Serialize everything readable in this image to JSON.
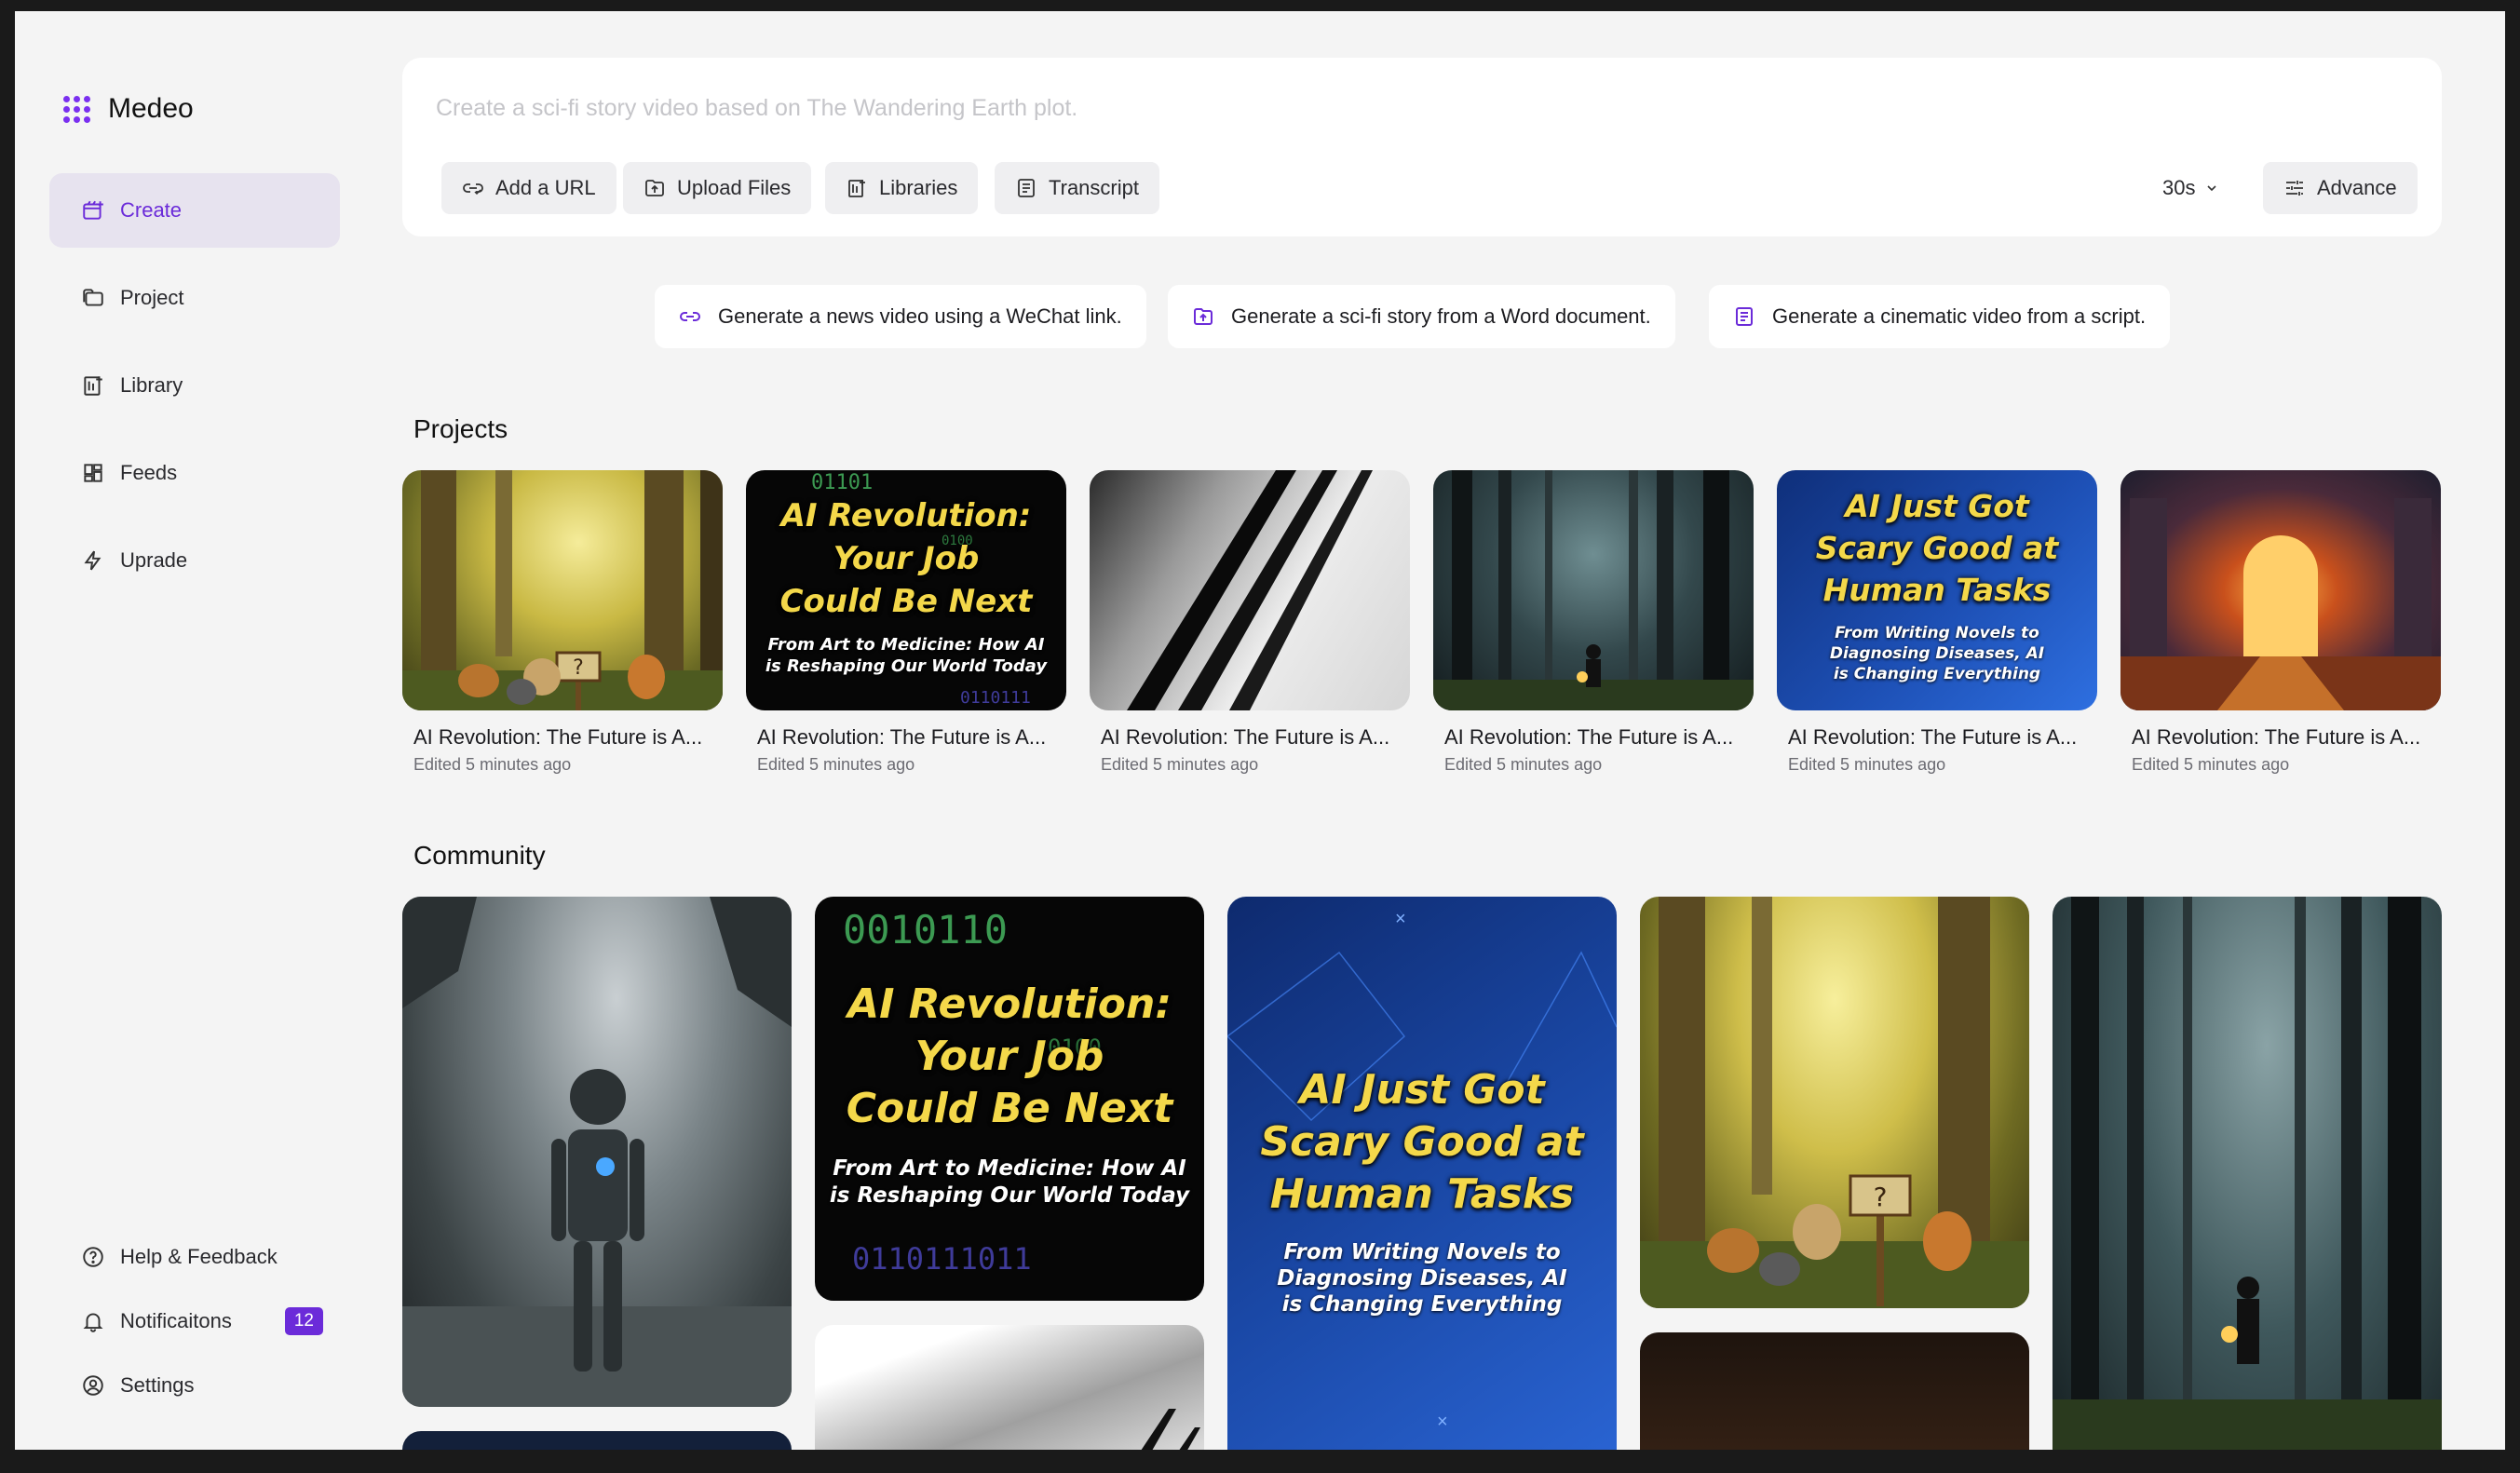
{
  "app": {
    "name": "Medeo"
  },
  "sidebar": {
    "items": [
      {
        "label": "Create",
        "icon": "create-icon"
      },
      {
        "label": "Project",
        "icon": "folder-icon"
      },
      {
        "label": "Library",
        "icon": "library-icon"
      },
      {
        "label": "Feeds",
        "icon": "grid-icon"
      },
      {
        "label": "Uprade",
        "icon": "bolt-icon"
      }
    ],
    "bottom": [
      {
        "label": "Help & Feedback",
        "icon": "help-icon"
      },
      {
        "label": "Notificaitons",
        "icon": "bell-icon",
        "badge": "12"
      },
      {
        "label": "Settings",
        "icon": "settings-icon"
      }
    ]
  },
  "prompt": {
    "placeholder": "Create a sci-fi story video based on The Wandering Earth plot.",
    "chips": [
      "Add a URL",
      "Upload Files",
      "Libraries",
      "Transcript"
    ],
    "duration": "30s",
    "advance": "Advance"
  },
  "suggestions": [
    "Generate a news video using a WeChat link.",
    "Generate a sci-fi story from a Word document.",
    "Generate a cinematic video from a script."
  ],
  "projects": {
    "title": "Projects",
    "items": [
      {
        "title": "AI Revolution: The Future is A...",
        "subtitle": "Edited 5 minutes ago",
        "thumb": "forest-animals"
      },
      {
        "title": "AI Revolution: The Future is A...",
        "subtitle": "Edited 5 minutes ago",
        "thumb": "job-poster"
      },
      {
        "title": "AI Revolution: The Future is A...",
        "subtitle": "Edited 5 minutes ago",
        "thumb": "claws"
      },
      {
        "title": "AI Revolution: The Future is A...",
        "subtitle": "Edited 5 minutes ago",
        "thumb": "dark-forest"
      },
      {
        "title": "AI Revolution: The Future is A...",
        "subtitle": "Edited 5 minutes ago",
        "thumb": "tasks-poster"
      },
      {
        "title": "AI Revolution: The Future is A...",
        "subtitle": "Edited 5 minutes ago",
        "thumb": "palace"
      }
    ]
  },
  "community": {
    "title": "Community"
  },
  "posters": {
    "job": {
      "headline": [
        "AI Revolution:",
        "Your Job",
        "Could Be Next"
      ],
      "sub": [
        "From Art to Medicine: How AI",
        "is Reshaping Our World Today"
      ]
    },
    "tasks": {
      "headline": [
        "AI Just Got",
        "Scary Good at",
        "Human Tasks"
      ],
      "sub": [
        "From Writing Novels to",
        "Diagnosing Diseases, AI",
        "is Changing Everything"
      ]
    }
  },
  "colors": {
    "accent": "#6b2bd9",
    "background": "#f4f4f4",
    "card": "#ffffff"
  }
}
